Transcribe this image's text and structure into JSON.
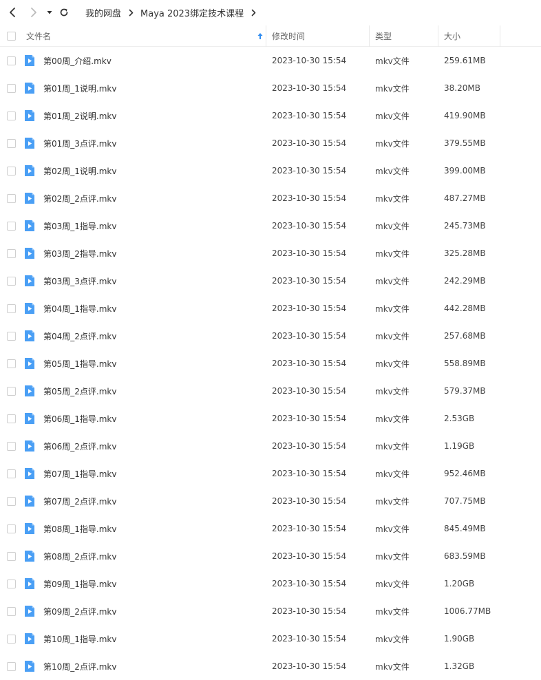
{
  "nav": {
    "breadcrumb": [
      "我的网盘",
      "Maya 2023绑定技术课程"
    ]
  },
  "header": {
    "name": "文件名",
    "modified": "修改时间",
    "type": "类型",
    "size": "大小"
  },
  "icons": {
    "back": "chevron-left-icon",
    "forward": "chevron-right-icon",
    "history": "caret-down-icon",
    "refresh": "refresh-icon",
    "file": "video-file-icon",
    "sort": "sort-ascending-icon"
  },
  "colors": {
    "file_icon": "#4a9ff5",
    "sort_arrow": "#2f8cf0"
  },
  "files": [
    {
      "name": "第00周_介绍.mkv",
      "modified": "2023-10-30 15:54",
      "type": "mkv文件",
      "size": "259.61MB"
    },
    {
      "name": "第01周_1说明.mkv",
      "modified": "2023-10-30 15:54",
      "type": "mkv文件",
      "size": "38.20MB"
    },
    {
      "name": "第01周_2说明.mkv",
      "modified": "2023-10-30 15:54",
      "type": "mkv文件",
      "size": "419.90MB"
    },
    {
      "name": "第01周_3点评.mkv",
      "modified": "2023-10-30 15:54",
      "type": "mkv文件",
      "size": "379.55MB"
    },
    {
      "name": "第02周_1说明.mkv",
      "modified": "2023-10-30 15:54",
      "type": "mkv文件",
      "size": "399.00MB"
    },
    {
      "name": "第02周_2点评.mkv",
      "modified": "2023-10-30 15:54",
      "type": "mkv文件",
      "size": "487.27MB"
    },
    {
      "name": "第03周_1指导.mkv",
      "modified": "2023-10-30 15:54",
      "type": "mkv文件",
      "size": "245.73MB"
    },
    {
      "name": "第03周_2指导.mkv",
      "modified": "2023-10-30 15:54",
      "type": "mkv文件",
      "size": "325.28MB"
    },
    {
      "name": "第03周_3点评.mkv",
      "modified": "2023-10-30 15:54",
      "type": "mkv文件",
      "size": "242.29MB"
    },
    {
      "name": "第04周_1指导.mkv",
      "modified": "2023-10-30 15:54",
      "type": "mkv文件",
      "size": "442.28MB"
    },
    {
      "name": "第04周_2点评.mkv",
      "modified": "2023-10-30 15:54",
      "type": "mkv文件",
      "size": "257.68MB"
    },
    {
      "name": "第05周_1指导.mkv",
      "modified": "2023-10-30 15:54",
      "type": "mkv文件",
      "size": "558.89MB"
    },
    {
      "name": "第05周_2点评.mkv",
      "modified": "2023-10-30 15:54",
      "type": "mkv文件",
      "size": "579.37MB"
    },
    {
      "name": "第06周_1指导.mkv",
      "modified": "2023-10-30 15:54",
      "type": "mkv文件",
      "size": "2.53GB"
    },
    {
      "name": "第06周_2点评.mkv",
      "modified": "2023-10-30 15:54",
      "type": "mkv文件",
      "size": "1.19GB"
    },
    {
      "name": "第07周_1指导.mkv",
      "modified": "2023-10-30 15:54",
      "type": "mkv文件",
      "size": "952.46MB"
    },
    {
      "name": "第07周_2点评.mkv",
      "modified": "2023-10-30 15:54",
      "type": "mkv文件",
      "size": "707.75MB"
    },
    {
      "name": "第08周_1指导.mkv",
      "modified": "2023-10-30 15:54",
      "type": "mkv文件",
      "size": "845.49MB"
    },
    {
      "name": "第08周_2点评.mkv",
      "modified": "2023-10-30 15:54",
      "type": "mkv文件",
      "size": "683.59MB"
    },
    {
      "name": "第09周_1指导.mkv",
      "modified": "2023-10-30 15:54",
      "type": "mkv文件",
      "size": "1.20GB"
    },
    {
      "name": "第09周_2点评.mkv",
      "modified": "2023-10-30 15:54",
      "type": "mkv文件",
      "size": "1006.77MB"
    },
    {
      "name": "第10周_1指导.mkv",
      "modified": "2023-10-30 15:54",
      "type": "mkv文件",
      "size": "1.90GB"
    },
    {
      "name": "第10周_2点评.mkv",
      "modified": "2023-10-30 15:54",
      "type": "mkv文件",
      "size": "1.32GB"
    }
  ]
}
